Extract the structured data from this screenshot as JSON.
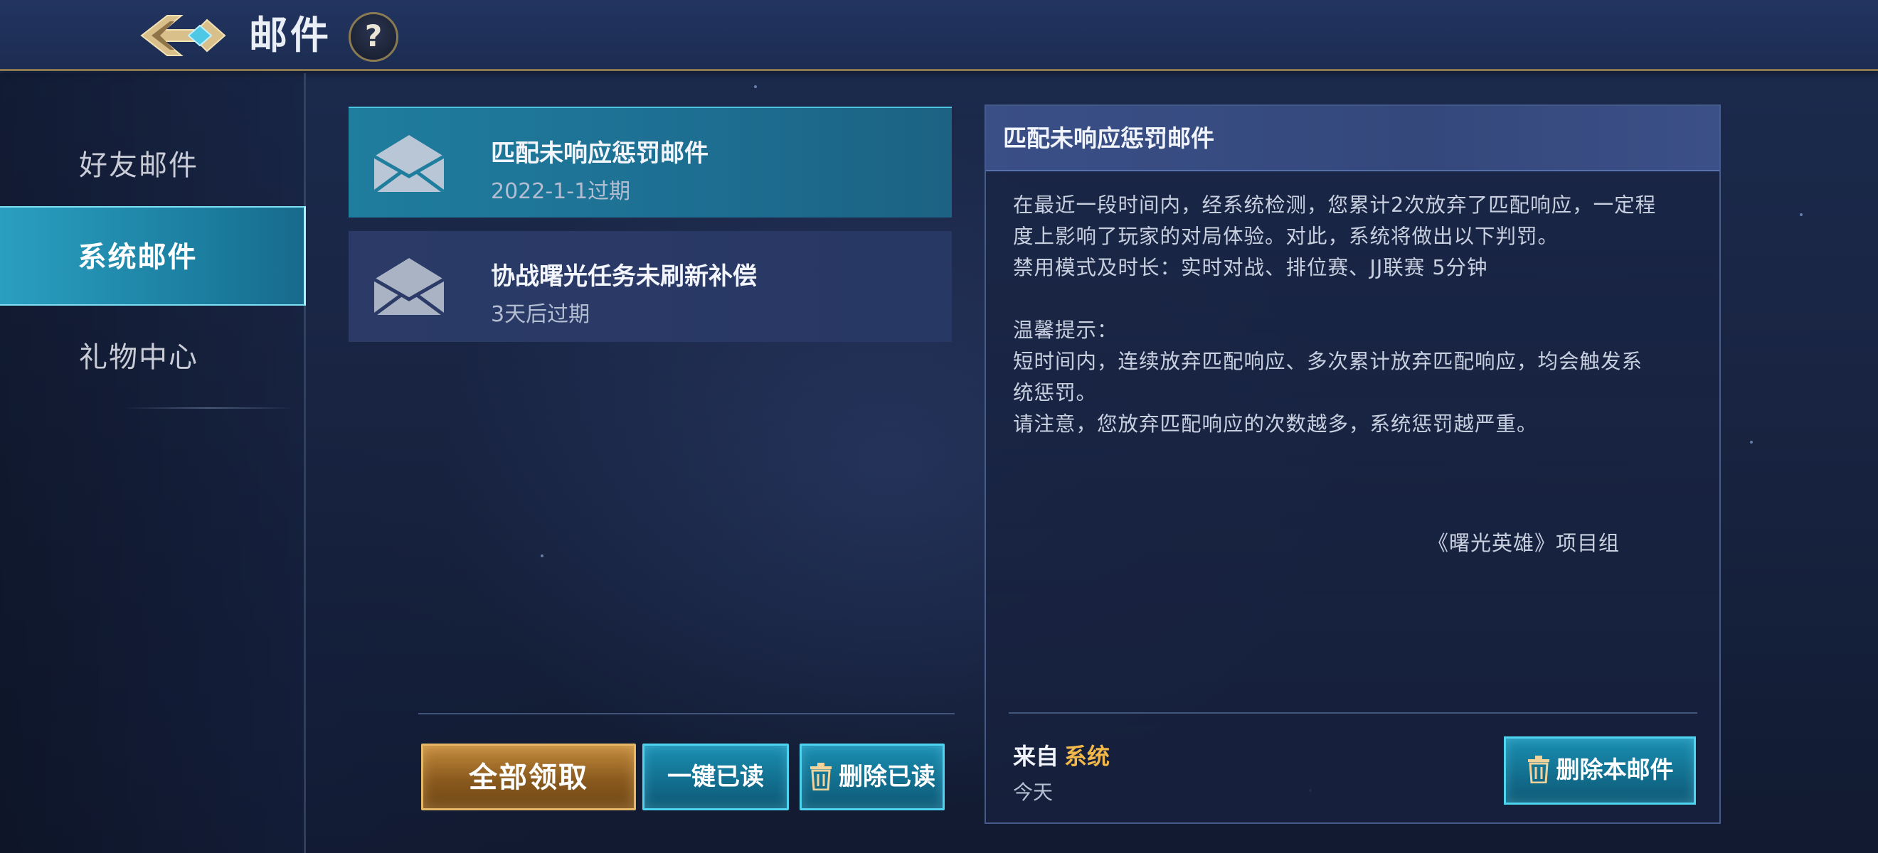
{
  "header": {
    "title": "邮件",
    "help_label": "?"
  },
  "sidebar": {
    "items": [
      {
        "label": "好友邮件",
        "active": false
      },
      {
        "label": "系统邮件",
        "active": true
      },
      {
        "label": "礼物中心",
        "active": false
      }
    ]
  },
  "mail_list": [
    {
      "title": "匹配未响应惩罚邮件",
      "expiry": "2022-1-1过期",
      "selected": true,
      "icon": "envelope-icon"
    },
    {
      "title": "协战曙光任务未刷新补偿",
      "expiry": "3天后过期",
      "selected": false,
      "icon": "envelope-icon"
    }
  ],
  "list_actions": {
    "claim_all": "全部领取",
    "mark_all_read": "一键已读",
    "delete_read": "删除已读"
  },
  "detail": {
    "title": "匹配未响应惩罚邮件",
    "body": "在最近一段时间内，经系统检测，您累计2次放弃了匹配响应，一定程\n度上影响了玩家的对局体验。对此，系统将做出以下判罚。\n禁用模式及时长：实时对战、排位赛、JJ联赛 5分钟\n\n温馨提示：\n短时间内，连续放弃匹配响应、多次累计放弃匹配响应，均会触发系\n统惩罚。\n请注意，您放弃匹配响应的次数越多，系统惩罚越严重。",
    "signature": "《曙光英雄》项目组",
    "from_label": "来自",
    "sender": "系统",
    "date": "今天",
    "delete_label": "删除本邮件"
  },
  "colors": {
    "accent_cyan": "#1f7d9e",
    "accent_gold": "#c28a3c",
    "sender_gold": "#f2b94a"
  }
}
